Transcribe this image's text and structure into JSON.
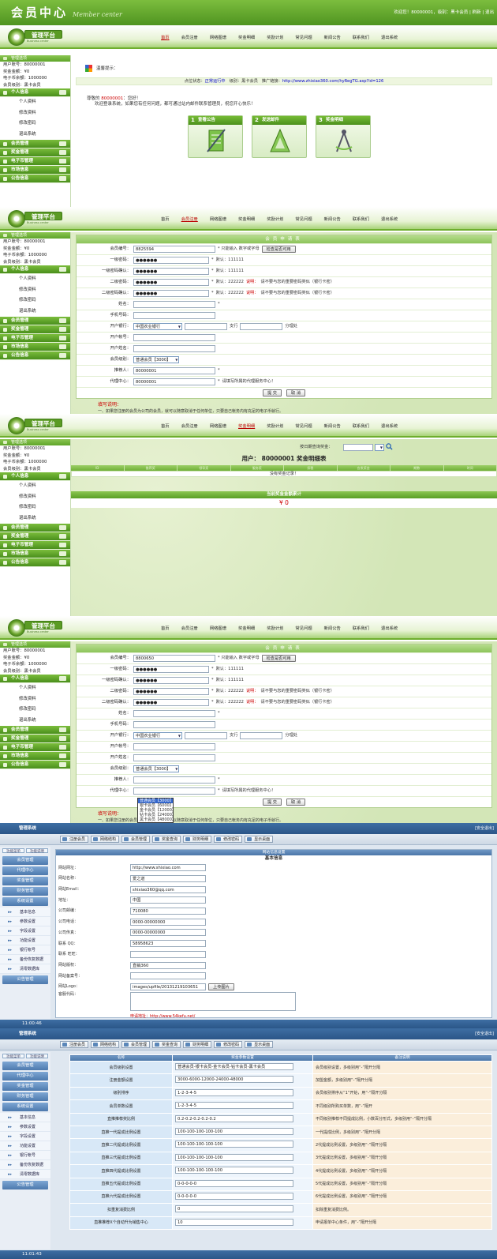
{
  "header": {
    "title": "会员中心",
    "subtitle": "Member center",
    "user_bar": "欢迎您！80000001，级别：黑卡会员 | 刷新 | 退出"
  },
  "logo": {
    "text": "管理平台",
    "sub": "Business center"
  },
  "nav": [
    "首页",
    "会员注册",
    "网络图谱",
    "奖金明细",
    "奖励计划",
    "常见问题",
    "新闻公告",
    "联系我们",
    "退出系统"
  ],
  "sidebar": {
    "panel_title": "管理选项",
    "p1_info": [
      "用户账号：80000001",
      "奖金金额：¥0",
      "电子币余额：1000000",
      "会员级别：黑卡会员"
    ],
    "p2_info": [
      "用户账号：80000001",
      "奖金金额：¥0",
      "电子币余额：1000000",
      "会员级别：黑卡会员"
    ],
    "personal": "个人信息",
    "sub": [
      "个人资料",
      "修改资料",
      "修改密码",
      "退出系统"
    ],
    "sections": [
      "会员管理",
      "奖金管理",
      "电子币管理",
      "市场信息",
      "公告信息"
    ]
  },
  "p1": {
    "tip": "温馨提示：",
    "status_prefix": "点位状态：",
    "status_value": "正常运行中",
    "level_label": "级别：",
    "level_value": "黑卡会员",
    "promo_label": "推广链接",
    "promo_url": "http://www.zhixiao360.com/hyRegTG.asp?id=126",
    "welcome_prefix": "尊敬的",
    "welcome_user": "80000001",
    "welcome_suffix": "：您好！",
    "welcome_line2": "欢迎登录系统，如果您有任何问题，都可通过站内邮件联系管理员，祝您开心快乐！",
    "cards": [
      {
        "num": "1",
        "label": "查看公告"
      },
      {
        "num": "2",
        "label": "发送邮件"
      },
      {
        "num": "3",
        "label": "奖金明细"
      }
    ]
  },
  "reg": {
    "title": "会员申请表",
    "labels": [
      "会员编号：",
      "一级密码：",
      "一级密码确认：",
      "二级密码：",
      "二级密码确认：",
      "姓名：",
      "手机号码：",
      "开户银行：",
      "开户帐号：",
      "开户姓名：",
      "会员级别：",
      "推荐人：",
      "代理中心："
    ],
    "id_a": "8825594",
    "id_b": "8800650",
    "id_hint": "* 只能输入 数字或字母",
    "check_btn": "检查是否可用",
    "pwd_mask": "●●●●●●",
    "pwd1_hint": "默认：111111",
    "pwd2_hint_pre": "默认：222222",
    "pwd2_hint_key": "说明：",
    "pwd2_hint_post": "请不要与您的重要密码类似（银行卡密）",
    "star": "*",
    "bank": "中国农业银行",
    "branch": "支行",
    "branch2": "分理处",
    "level": "普通会员【3000】",
    "referrer": "80000001",
    "agent": "80000001",
    "agent_hint": "请填写所属的代理服务中心！",
    "submit": "提 交",
    "cancel": "取 消",
    "note_title": "填写说明：",
    "note_text": "一、如果您注册的会员为公司的会员，就可以随意取消于任何单位，只要自己帐务内有充足的电子币就行。",
    "level_options": [
      "普通会员【3000】",
      "银卡会员【6000】",
      "金卡会员【12000】",
      "钻卡会员【24000】",
      "黑卡会员【48000】"
    ]
  },
  "p3": {
    "query_label": "按日期查询奖金：",
    "title": "用户： 80000001 奖金明细表",
    "cols": [
      "ID",
      "推荐奖",
      "领导奖",
      "服务奖",
      "扣税",
      "应发奖金",
      "期数",
      "时间"
    ],
    "norec": "没有奖金记录！",
    "total_label": "当前奖金金额累计",
    "total_value": "¥ 0"
  },
  "admin": {
    "title": "管理系统",
    "right": "[安全退出]",
    "tools": [
      "注册会员",
      "网络结构",
      "会员管理",
      "奖金查询",
      "财务明细",
      "修改密码",
      "显示桌面"
    ],
    "tabs": [
      "功能菜单",
      "功能说明"
    ],
    "menu": [
      "会员管理",
      "代理中心",
      "奖金管理",
      "财务管理",
      "系统设置"
    ],
    "sys_items": [
      "基本信息",
      "参数设置",
      "字段设置",
      "功能设置",
      "银行帐号",
      "备份恢复数据",
      "清零数据库"
    ],
    "foot_menu": "公告管理",
    "clock_a": "11:00:46",
    "clock_b": "11:01:43"
  },
  "site": {
    "head": "网站信息设置",
    "title": "基本信息",
    "rows": [
      {
        "label": "网站网址：",
        "value": "http://www.shixiao.com"
      },
      {
        "label": "网站名称：",
        "value": "爱之道"
      },
      {
        "label": "网站Email：",
        "value": "shixiao360@qq.com"
      },
      {
        "label": "地址：",
        "value": "中国"
      },
      {
        "label": "公司邮编：",
        "value": "710080"
      },
      {
        "label": "公司电话：",
        "value": "0000-00000000"
      },
      {
        "label": "公司传真：",
        "value": "0000-00000000"
      },
      {
        "label": "联系 QQ：",
        "value": "58958623"
      },
      {
        "label": "联系 旺旺：",
        "value": ""
      },
      {
        "label": "网站版权：",
        "value": "直销360"
      },
      {
        "label": "网站备案号：",
        "value": ""
      },
      {
        "label": "网站Logo：",
        "value": "images/upfile/20131219103651"
      }
    ],
    "stat_label": "客服代码：",
    "upload_btn": "上传图片",
    "apply_link": "申请地址：http://www.54kefu.net/"
  },
  "params": {
    "cols": [
      "名称",
      "奖金参数设置",
      "备注说明"
    ],
    "rows": [
      {
        "name": "会员级别设置",
        "value": "普通会员-银卡会员-金卡会员-钻卡会员-黑卡会员",
        "note": "会员级别设置，多级别用“-”隔开分隔"
      },
      {
        "name": "注册金额设置",
        "value": "3000-6000-12000-24000-48000",
        "note": "加盟金额，多级别用“-”隔开分隔"
      },
      {
        "name": "级别排序",
        "value": "1-2-3-4-5",
        "note": "会员级别排序从“1”开始，用“-”隔开分隔"
      },
      {
        "name": "会员单数设置",
        "value": "1-2-3-4-5",
        "note": "不同级别所购买单数，用“-”隔开"
      },
      {
        "name": "直推推荐奖比例",
        "value": "0.2-0.2-0.2-0.2-0.2",
        "note": "不同级别推荐不同提成比例，小数百分形式，多级别用“-”隔开分隔"
      },
      {
        "name": "直推一代提成比例设置",
        "value": "100-100-100-100-100",
        "note": "一代提成比例，多级别用“-”隔开分隔"
      },
      {
        "name": "直推二代提成比例设置",
        "value": "100-100-100-100-100",
        "note": "2代提成比例设置，多级别用“-”隔开分隔"
      },
      {
        "name": "直推三代提成比例设置",
        "value": "100-100-100-100-100",
        "note": "3代提成比例设置，多级别用“-”隔开分隔"
      },
      {
        "name": "直推四代提成比例设置",
        "value": "100-100-100-100-100",
        "note": "4代提成比例设置，多级别用“-”隔开分隔"
      },
      {
        "name": "直推五代提成比例设置",
        "value": "0-0-0-0-0",
        "note": "5代提成比例设置，多级别用“-”隔开分隔"
      },
      {
        "name": "直推六代提成比例设置",
        "value": "0-0-0-0-0",
        "note": "6代提成比例设置，多级别用“-”隔开分隔"
      },
      {
        "name": "扣重复消费比例",
        "value": "0",
        "note": "扣除重复消费比例。"
      },
      {
        "name": "直推推荐X个自动升为销售中心",
        "value": "10",
        "note": "申请报单中心条件，用“-”隔开分隔"
      }
    ]
  }
}
